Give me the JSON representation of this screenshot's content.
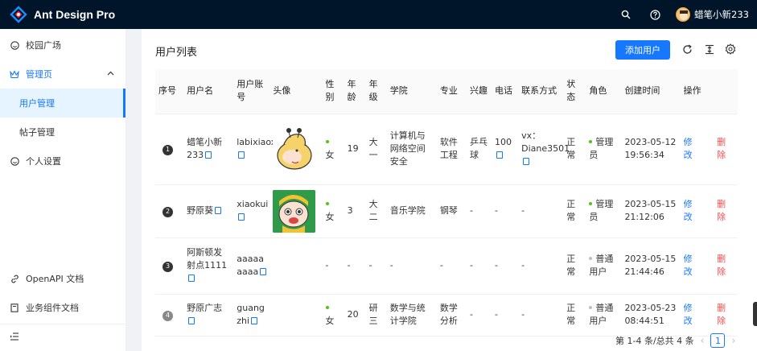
{
  "header": {
    "title": "Ant Design Pro",
    "user_name": "蜡笔小新233",
    "icons": [
      "search-icon",
      "question-icon"
    ]
  },
  "sidebar": {
    "items": [
      {
        "label": "校园广场",
        "icon": "smile-icon"
      },
      {
        "label": "管理页",
        "icon": "crown-icon"
      },
      {
        "label": "用户管理"
      },
      {
        "label": "帖子管理"
      },
      {
        "label": "个人设置",
        "icon": "smile-icon"
      }
    ],
    "bottom": [
      {
        "label": "OpenAPI 文档",
        "icon": "link-icon"
      },
      {
        "label": "业务组件文档",
        "icon": "file-icon"
      }
    ],
    "footer_icon": "menu-fold-icon"
  },
  "content": {
    "title": "用户列表",
    "add_button": "添加用户",
    "tools": [
      "reload-icon",
      "column-height-icon",
      "setting-icon"
    ]
  },
  "table": {
    "columns": [
      "序号",
      "用户名",
      "用户账号",
      "头像",
      "性别",
      "年龄",
      "年级",
      "学院",
      "专业",
      "兴趣",
      "电话",
      "联系方式",
      "状态",
      "角色",
      "创建时间",
      "操作"
    ],
    "rows": [
      {
        "index": "1",
        "username": "蜡笔小新233",
        "account": "labixiaoxin",
        "gender": "女",
        "age": "19",
        "grade": "大一",
        "college": "计算机与网络空间安全",
        "major": "软件工程",
        "interest": "乒乓球",
        "phone": "100",
        "contact": "vx：Diane3501",
        "status": "正常",
        "role": "管理员",
        "created": "2023-05-12 19:56:34",
        "edit": "修改",
        "delete": "删除"
      },
      {
        "index": "2",
        "username": "野原葵",
        "account": "xiaokui",
        "gender": "女",
        "age": "3",
        "grade": "大二",
        "college": "音乐学院",
        "major": "钢琴",
        "interest": "-",
        "phone": "-",
        "contact": "-",
        "status": "正常",
        "role": "管理员",
        "created": "2023-05-15 21:12:06",
        "edit": "修改",
        "delete": "删除"
      },
      {
        "index": "3",
        "username": "阿斯顿发射点1111",
        "account": "aaaaaaaaa",
        "gender": "-",
        "age": "-",
        "grade": "-",
        "college": "-",
        "major": "-",
        "interest": "-",
        "phone": "-",
        "contact": "-",
        "status": "正常",
        "role": "普通用户",
        "created": "2023-05-15 21:44:46",
        "edit": "修改",
        "delete": "删除"
      },
      {
        "index": "4",
        "username": "野原广志",
        "account": "guangzhi",
        "gender": "女",
        "age": "20",
        "grade": "研三",
        "college": "数学与统计学院",
        "major": "数学分析",
        "interest": "-",
        "phone": "-",
        "contact": "-",
        "status": "正常",
        "role": "普通用户",
        "created": "2023-05-23 08:44:51",
        "edit": "修改",
        "delete": "删除"
      }
    ]
  },
  "pagination": {
    "summary": "第 1-4 条/总共 4 条",
    "current": "1"
  },
  "colors": {
    "primary": "#1677ff",
    "header_bg": "#001529",
    "danger": "#ff4d4f",
    "success": "#52c41a"
  }
}
